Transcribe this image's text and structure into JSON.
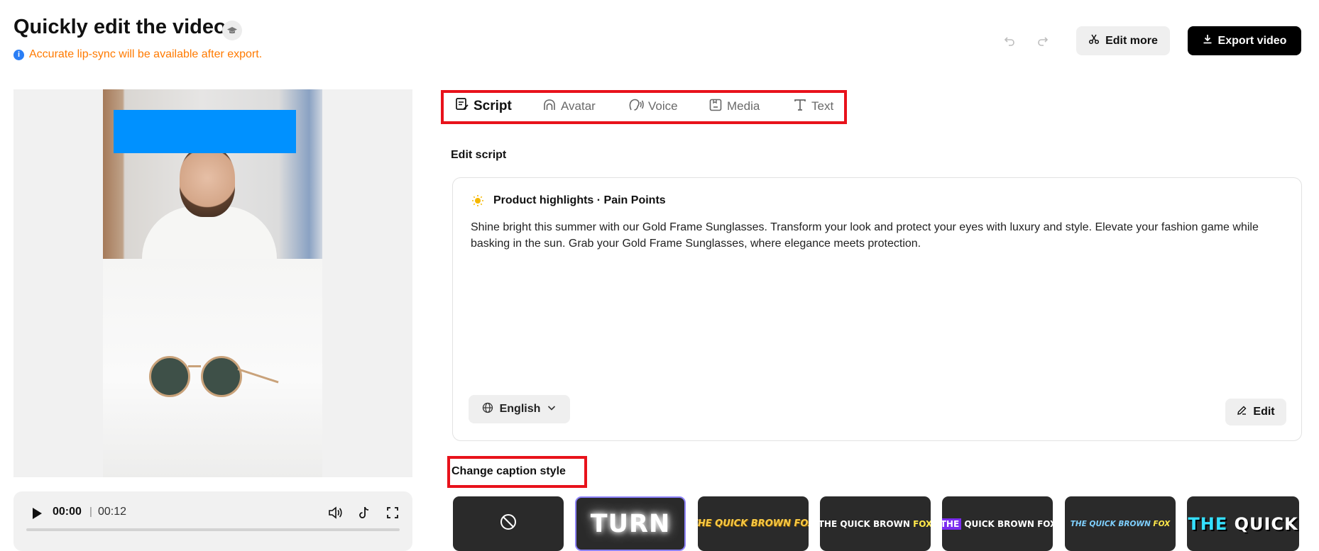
{
  "header": {
    "title": "Quickly edit the video",
    "notice": "Accurate lip-sync will be available after export.",
    "edit_more_label": "Edit more",
    "export_label": "Export video"
  },
  "player": {
    "current_time": "00:00",
    "separator": "|",
    "total_time": "00:12",
    "progress": 0
  },
  "tabs": [
    {
      "label": "Script",
      "icon": "script-icon",
      "active": true
    },
    {
      "label": "Avatar",
      "icon": "avatar-icon",
      "active": false
    },
    {
      "label": "Voice",
      "icon": "voice-icon",
      "active": false
    },
    {
      "label": "Media",
      "icon": "media-icon",
      "active": false
    },
    {
      "label": "Text",
      "icon": "text-icon",
      "active": false
    }
  ],
  "script": {
    "section_label": "Edit script",
    "card_title": "Product highlights · Pain Points",
    "text": "Shine bright this summer with our Gold Frame Sunglasses. Transform your look and protect your eyes with luxury and style. Elevate your fashion game while basking in the sun. Grab your Gold Frame Sunglasses, where elegance meets protection.",
    "language": "English",
    "edit_label": "Edit"
  },
  "captions": {
    "section_label": "Change caption style",
    "styles": [
      {
        "id": "none",
        "preview": ""
      },
      {
        "id": "turn",
        "preview": "TURN"
      },
      {
        "id": "yellow-italic",
        "preview": "THE QUICK BROWN FOX"
      },
      {
        "id": "yellow-word",
        "preview_a": "THE QUICK BROWN ",
        "preview_b": "FOX"
      },
      {
        "id": "purple-highlight",
        "preview_a": "THE",
        "preview_b": " QUICK BROWN FOX"
      },
      {
        "id": "blue-italic",
        "preview_a": "THE QUICK BROWN ",
        "preview_b": "FOX"
      },
      {
        "id": "big-cyan",
        "preview_a": "THE",
        "preview_b": " QUICK"
      }
    ],
    "selected": "turn"
  },
  "colors": {
    "accent_red": "#e8121b",
    "notice_orange": "#ff7a00",
    "selected_border": "#8e83ff",
    "overlay_blue": "#0091ff"
  }
}
